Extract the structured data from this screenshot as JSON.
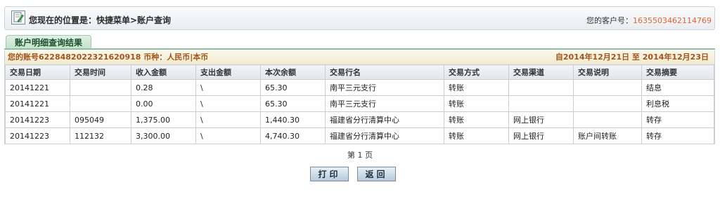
{
  "location": {
    "text": "您现在的位置是：快捷菜单>账户查询"
  },
  "customer": {
    "label": "您的客户号：",
    "number": "1635503462114769"
  },
  "tab": {
    "label": "账户明细查询结果"
  },
  "account_info": {
    "account": "您的账号6228482022321620918  币种：人民币|本币",
    "date_range": "自2014年12月21日  至  2014年12月23日"
  },
  "table": {
    "headers": [
      "交易日期",
      "交易时间",
      "收入金额",
      "支出金额",
      "本次余额",
      "交易行名",
      "交易方式",
      "交易渠道",
      "交易说明",
      "交易摘要"
    ],
    "rows": [
      [
        "20141221",
        "",
        "0.28",
        "\\",
        "65.30",
        "南平三元支行",
        "转账",
        "",
        "",
        "结息"
      ],
      [
        "20141221",
        "",
        "0.00",
        "\\",
        "65.30",
        "南平三元支行",
        "转账",
        "",
        "",
        "利息税"
      ],
      [
        "20141223",
        "095049",
        "1,375.00",
        "\\",
        "1,440.30",
        "福建省分行清算中心",
        "转账",
        "网上银行",
        "",
        "转存"
      ],
      [
        "20141223",
        "112132",
        "3,300.00",
        "\\",
        "4,740.30",
        "福建省分行清算中心",
        "转账",
        "网上银行",
        "账户间转账",
        "转存"
      ]
    ]
  },
  "pagination": {
    "text": "第 1 页"
  },
  "buttons": {
    "print": "打印",
    "back": "返回"
  }
}
